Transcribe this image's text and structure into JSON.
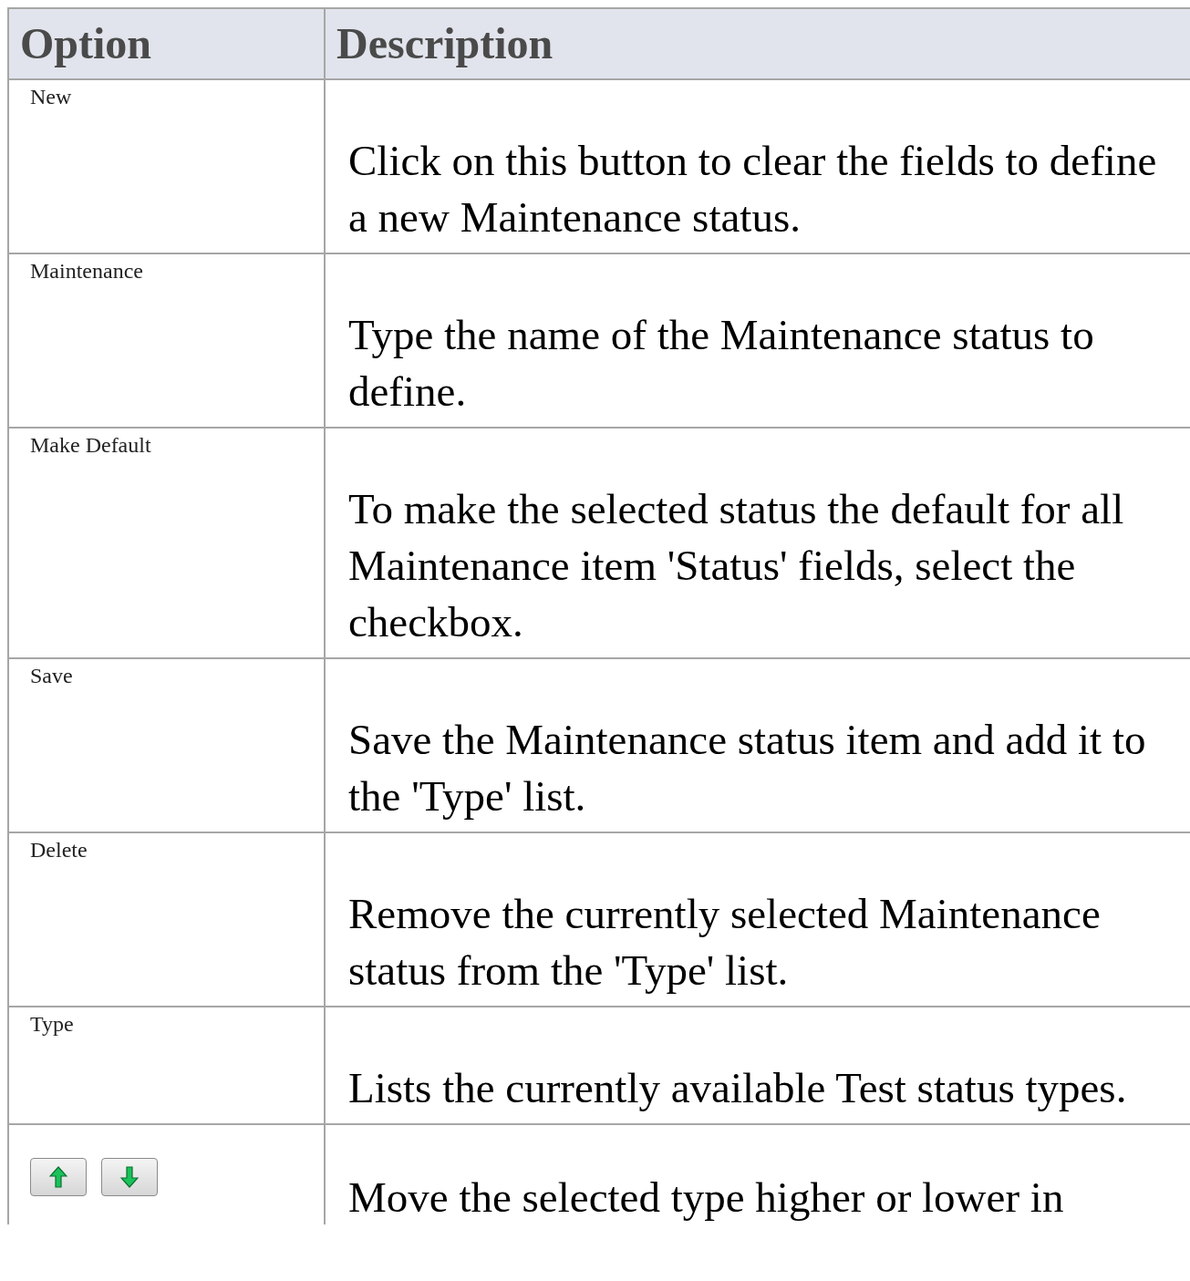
{
  "table": {
    "columns": [
      "Option",
      "Description"
    ],
    "rows": [
      {
        "kind": "text",
        "option": "New",
        "description": "Click on this button to clear the fields to define a new Maintenance status."
      },
      {
        "kind": "text",
        "option": "Maintenance",
        "description": "Type the name of the Maintenance status to define."
      },
      {
        "kind": "text",
        "option": "Make Default",
        "description": "To make the selected status the default for all Maintenance item 'Status' fields, select the checkbox."
      },
      {
        "kind": "text",
        "option": "Save",
        "description": "Save the Maintenance status item and add it to the 'Type' list."
      },
      {
        "kind": "text",
        "option": "Delete",
        "description": "Remove the currently selected Maintenance status from the 'Type' list."
      },
      {
        "kind": "text",
        "option": "Type",
        "description": "Lists the currently available Test status types."
      },
      {
        "kind": "move-buttons",
        "description": "Move the selected type higher or lower in"
      }
    ]
  }
}
